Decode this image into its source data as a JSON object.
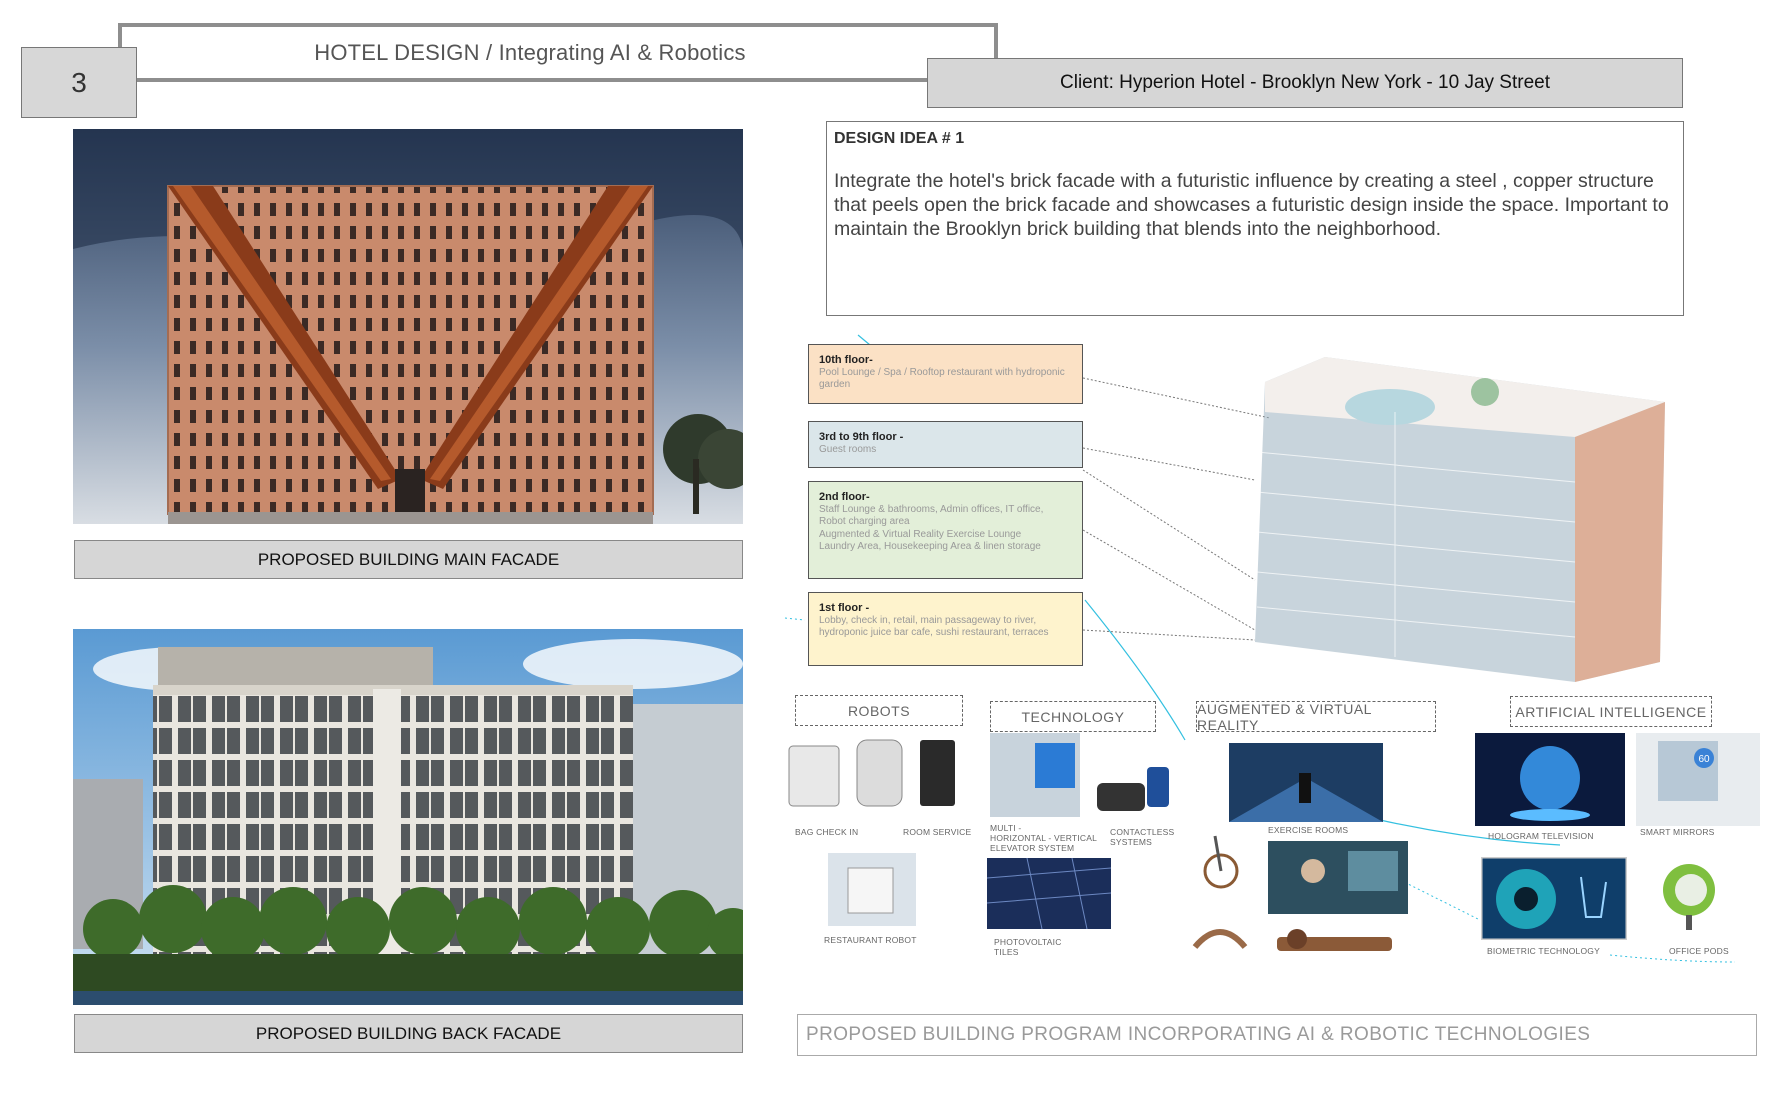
{
  "header": {
    "page_number": "3",
    "title": "HOTEL DESIGN / Integrating AI & Robotics",
    "client": "Client: Hyperion Hotel -  Brooklyn New York - 10 Jay Street"
  },
  "facades": {
    "main_caption": "PROPOSED BUILDING MAIN FACADE",
    "back_caption": "PROPOSED BUILDING BACK FACADE"
  },
  "design_idea": {
    "heading": "DESIGN IDEA # 1",
    "body": "Integrate the hotel's brick facade with a futuristic influence by creating a steel , copper structure that peels open the brick facade and showcases a futuristic design inside the space. Important to maintain the Brooklyn brick building that blends into the neighborhood."
  },
  "floors": [
    {
      "heading": "10th floor-",
      "desc": "Pool Lounge / Spa / Rooftop restaurant  with hydroponic garden",
      "color": "#fbe1c5"
    },
    {
      "heading": "3rd to 9th floor -",
      "desc": "Guest rooms",
      "color": "#dbe6ea"
    },
    {
      "heading": "2nd floor-",
      "desc": "Staff Lounge & bathrooms, Admin offices, IT office, Robot charging area\nAugmented & Virtual Reality Exercise Lounge\nLaundry Area, Housekeeping Area & linen storage",
      "color": "#e3efd9"
    },
    {
      "heading": "1st floor -",
      "desc": "Lobby, check in, retail, main passageway to river, hydroponic juice bar cafe, sushi restaurant, terraces",
      "color": "#fef3cd"
    }
  ],
  "categories": {
    "robots": "ROBOTS",
    "technology": "TECHNOLOGY",
    "ar_vr": "AUGMENTED & VIRTUAL REALITY",
    "ai": "ARTIFICIAL INTELLIGENCE"
  },
  "items": {
    "bag_check_in": "BAG CHECK IN",
    "room_service": "ROOM SERVICE",
    "restaurant_robot": "RESTAURANT ROBOT",
    "elevator": "MULTI -\nHORIZONTAL - VERTICAL\nELEVATOR SYSTEM",
    "contactless": "CONTACTLESS\nSYSTEMS",
    "photovoltaic": "PHOTOVOLTAIC\nTILES",
    "exercise_rooms": "EXERCISE ROOMS",
    "hologram_tv": "HOLOGRAM TELEVISION",
    "smart_mirrors": "SMART MIRRORS",
    "biometric": "BIOMETRIC TECHNOLOGY",
    "office_pods": "OFFICE PODS",
    "mirror_screen": "60"
  },
  "program_caption": "PROPOSED BUILDING PROGRAM INCORPORATING AI & ROBOTIC TECHNOLOGIES"
}
